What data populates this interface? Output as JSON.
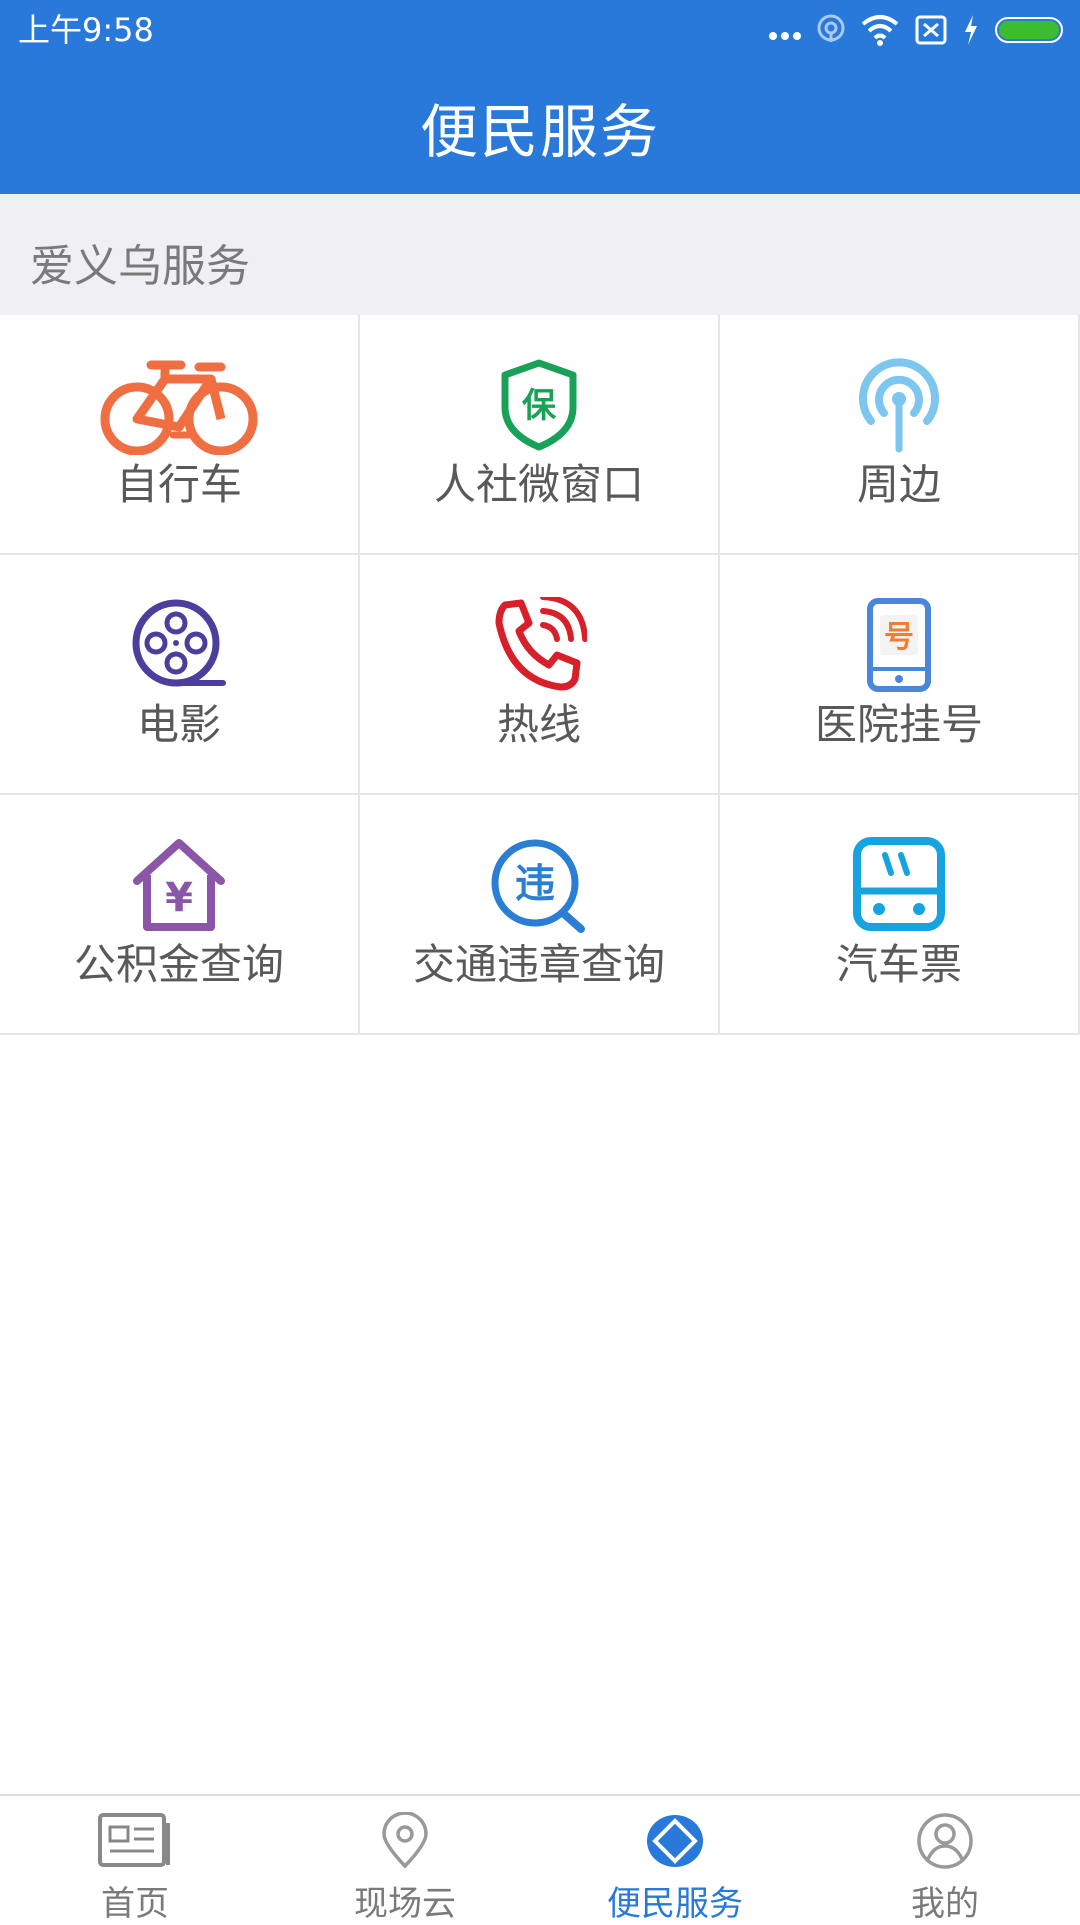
{
  "status_bar": {
    "time": "上午9:58",
    "icons": [
      "more-dots-icon",
      "hotspot-icon",
      "wifi-icon",
      "no-sim-icon",
      "charging-icon",
      "battery-icon"
    ]
  },
  "header": {
    "title": "便民服务"
  },
  "section": {
    "title": "爱义乌服务"
  },
  "services": [
    {
      "label": "自行车",
      "icon": "bicycle-icon",
      "color": "#ef6f43"
    },
    {
      "label": "人社微窗口",
      "icon": "shield-bao-icon",
      "color": "#1aa158",
      "glyph": "保"
    },
    {
      "label": "周边",
      "icon": "signal-tower-icon",
      "color": "#7cc6ef"
    },
    {
      "label": "电影",
      "icon": "film-reel-icon",
      "color": "#4b3f9e"
    },
    {
      "label": "热线",
      "icon": "phone-icon",
      "color": "#d7202a"
    },
    {
      "label": "医院挂号",
      "icon": "mobile-hao-icon",
      "color": "#4a86d9",
      "glyph": "号"
    },
    {
      "label": "公积金查询",
      "icon": "house-yen-icon",
      "color": "#8b56a8",
      "glyph": "¥"
    },
    {
      "label": "交通违章查询",
      "icon": "violation-search-icon",
      "color": "#2a7fd4",
      "glyph": "违"
    },
    {
      "label": "汽车票",
      "icon": "bus-icon",
      "color": "#17a3e0"
    }
  ],
  "tabbar": {
    "active_color": "#2879d9",
    "items": [
      {
        "label": "首页",
        "icon": "newspaper-icon",
        "active": false
      },
      {
        "label": "现场云",
        "icon": "location-pin-icon",
        "active": false
      },
      {
        "label": "便民服务",
        "icon": "services-icon",
        "active": true
      },
      {
        "label": "我的",
        "icon": "profile-icon",
        "active": false
      }
    ]
  }
}
